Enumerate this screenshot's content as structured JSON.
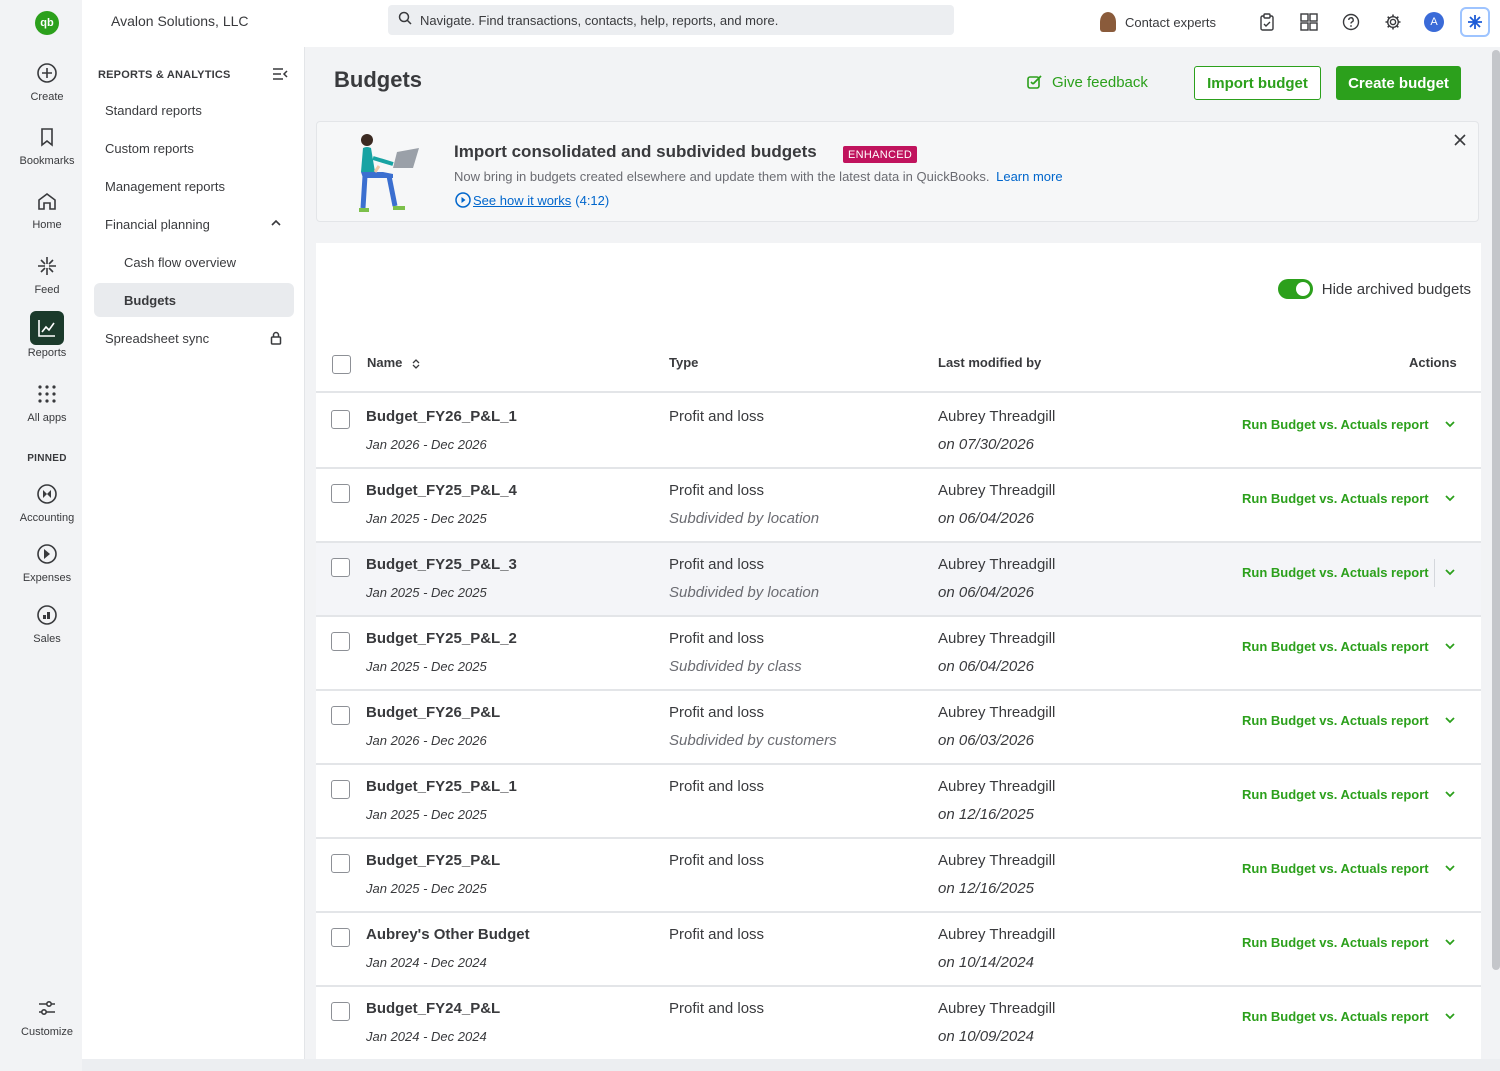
{
  "app": {
    "logo_text": "qb",
    "company_name": "Avalon Solutions, LLC",
    "search_placeholder": "Navigate. Find transactions, contacts, help, reports, and more.",
    "contact_experts": "Contact experts",
    "avatar_letter": "A"
  },
  "rail": {
    "items": [
      {
        "label": "Create",
        "icon": "plus-circle-icon"
      },
      {
        "label": "Bookmarks",
        "icon": "bookmark-icon"
      },
      {
        "label": "Home",
        "icon": "home-icon"
      },
      {
        "label": "Feed",
        "icon": "sparkle-icon"
      },
      {
        "label": "Reports",
        "icon": "chart-icon"
      },
      {
        "label": "All apps",
        "icon": "grid-icon"
      }
    ],
    "pinned_label": "PINNED",
    "pinned": [
      {
        "label": "Accounting",
        "icon": "accounting-icon"
      },
      {
        "label": "Expenses",
        "icon": "expenses-icon"
      },
      {
        "label": "Sales",
        "icon": "sales-icon"
      }
    ],
    "customize": "Customize"
  },
  "subnav": {
    "heading": "REPORTS & ANALYTICS",
    "items": [
      {
        "label": "Standard reports"
      },
      {
        "label": "Custom reports"
      },
      {
        "label": "Management reports"
      },
      {
        "label": "Financial planning"
      },
      {
        "label": "Cash flow overview"
      },
      {
        "label": "Budgets"
      },
      {
        "label": "Spreadsheet sync"
      }
    ]
  },
  "page": {
    "title": "Budgets",
    "give_feedback": "Give feedback",
    "import_budget": "Import budget",
    "create_budget": "Create budget"
  },
  "banner": {
    "title": "Import consolidated and subdivided budgets",
    "badge": "ENHANCED",
    "description": "Now bring in budgets created elsewhere and update them with the latest data in QuickBooks.",
    "learn_more": "Learn more",
    "video_link": "See how it works",
    "video_duration": "(4:12)"
  },
  "table": {
    "hide_archived_label": "Hide archived budgets",
    "hide_archived_on": true,
    "columns": {
      "name": "Name",
      "type": "Type",
      "modified": "Last modified by",
      "actions": "Actions"
    },
    "action_label": "Run Budget vs. Actuals report",
    "rows": [
      {
        "name": "Budget_FY26_P&L_1",
        "range": "Jan 2026 - Dec 2026",
        "type": "Profit and loss",
        "subdivided": "",
        "by": "Aubrey Threadgill",
        "on": "on 07/30/2026"
      },
      {
        "name": "Budget_FY25_P&L_4",
        "range": "Jan 2025 - Dec 2025",
        "type": "Profit and loss",
        "subdivided": "Subdivided by location",
        "by": "Aubrey Threadgill",
        "on": "on 06/04/2026"
      },
      {
        "name": "Budget_FY25_P&L_3",
        "range": "Jan 2025 - Dec 2025",
        "type": "Profit and loss",
        "subdivided": "Subdivided by location",
        "by": "Aubrey Threadgill",
        "on": "on 06/04/2026"
      },
      {
        "name": "Budget_FY25_P&L_2",
        "range": "Jan 2025 - Dec 2025",
        "type": "Profit and loss",
        "subdivided": "Subdivided by class",
        "by": "Aubrey Threadgill",
        "on": "on 06/04/2026"
      },
      {
        "name": "Budget_FY26_P&L",
        "range": "Jan 2026 - Dec 2026",
        "type": "Profit and loss",
        "subdivided": "Subdivided by customers",
        "by": "Aubrey Threadgill",
        "on": "on 06/03/2026"
      },
      {
        "name": "Budget_FY25_P&L_1",
        "range": "Jan 2025 - Dec 2025",
        "type": "Profit and loss",
        "subdivided": "",
        "by": "Aubrey Threadgill",
        "on": "on 12/16/2025"
      },
      {
        "name": "Budget_FY25_P&L",
        "range": "Jan 2025 - Dec 2025",
        "type": "Profit and loss",
        "subdivided": "",
        "by": "Aubrey Threadgill",
        "on": "on 12/16/2025"
      },
      {
        "name": "Aubrey's Other Budget",
        "range": "Jan 2024 - Dec 2024",
        "type": "Profit and loss",
        "subdivided": "",
        "by": "Aubrey Threadgill",
        "on": "on 10/14/2024"
      },
      {
        "name": "Budget_FY24_P&L",
        "range": "Jan 2024 - Dec 2024",
        "type": "Profit and loss",
        "subdivided": "",
        "by": "Aubrey Threadgill",
        "on": "on 10/09/2024"
      }
    ]
  },
  "colors": {
    "brand_green": "#2ca01c",
    "badge": "#c0135d",
    "link": "#0066cc"
  }
}
